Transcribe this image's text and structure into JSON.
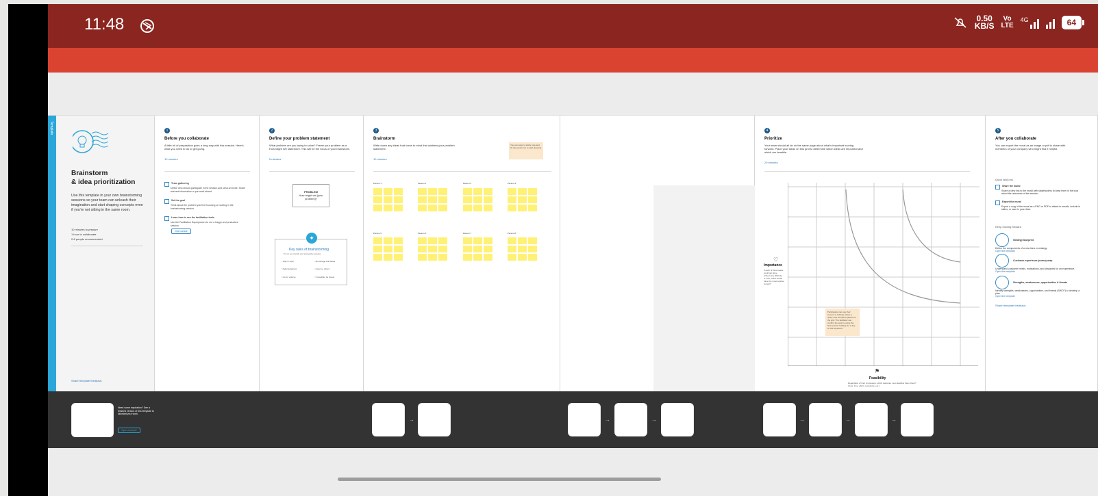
{
  "status_bar": {
    "time": "11:48",
    "net_speed_value": "0.50",
    "net_speed_unit": "KB/S",
    "volte_top": "Vo",
    "volte_bottom": "LTE",
    "network_label": "4G",
    "battery_level": "64",
    "icons": [
      "dnd-icon",
      "mute-icon",
      "signal-4g-icon",
      "signal-icon",
      "battery-icon"
    ]
  },
  "template_strip_label": "Template",
  "panel_intro": {
    "title_line1": "Brainstorm",
    "title_line2": "& idea prioritization",
    "description": "Use this template in your own brainstorming sessions so your team can unleash their imagination and start shaping concepts even if you're not sitting in the same room.",
    "meta": [
      "10 minutes to prepare",
      "1 hour to collaborate",
      "2-8 people recommended"
    ],
    "feedback_link": "Share template feedback"
  },
  "panel_before": {
    "step": "1",
    "title": "Before you collaborate",
    "description": "A little bit of preparation goes a long way with this session. Here's what you need to do to get going.",
    "time": "10 minutes",
    "items": [
      {
        "title": "Team gathering",
        "text": "Define who should participate in the session and send an invite. Share relevant information or pre-work ahead."
      },
      {
        "title": "Set the goal",
        "text": "Think about the problem you'll be focusing on solving in the brainstorming session."
      },
      {
        "title": "Learn how to use the facilitation tools",
        "text": "Use the Facilitation Superpowers to run a happy and productive session."
      }
    ],
    "chip": "Open article"
  },
  "panel_define": {
    "step": "2",
    "title": "Define your problem statement",
    "description": "What problem are you trying to solve? Frame your problem as a How Might We statement. This will be the focus of your brainstorm.",
    "time": "5 minutes",
    "problem_label": "PROBLEM",
    "problem_text": "How might we [your problem]?",
    "rules_title": "Key rules of brainstorming",
    "rules_subtitle": "To run an smooth and productive session",
    "rules": [
      "Stay in topic.",
      "Encourage wild ideas.",
      "Defer judgment.",
      "Listen to others.",
      "Go for volume.",
      "If possible, be visual."
    ]
  },
  "panel_brainstorm": {
    "step": "3",
    "title": "Brainstorm",
    "description": "Write down any ideas that come to mind that address your problem statement.",
    "time": "10 minutes",
    "tip": "You can select a sticky note and hit the pencil icon to start drawing!",
    "persons": [
      "Person 1",
      "Person 2",
      "Person 3",
      "Person 4",
      "Person 5",
      "Person 6",
      "Person 7",
      "Person 8"
    ]
  },
  "panel_prioritize": {
    "step": "4",
    "title": "Prioritize",
    "description": "Your team should all be on the same page about what's important moving forward. Place your ideas on this grid to determine which ideas are important and which are feasible.",
    "time": "20 minutes",
    "y_label": "Importance",
    "y_desc": "If each of these tasks could get done without any difficulty or cost, which would have the most positive impact?",
    "x_label": "Feasibility",
    "x_desc": "Regardless of their importance, which tasks are more feasible than others? (Cost, time, effort, complexity, etc.)",
    "note": "Participants can use their cursors to indicate where a sticky note should be placed on the grid. The facilitator can confirm the spot by using the laser pointer holding the H key on the keyboard."
  },
  "panel_after": {
    "step": "5",
    "title": "After you collaborate",
    "description": "You can export the mural as an image or pdf to share with members of your company who might find it helpful.",
    "quick_label": "Quick add-ons",
    "quick_items": [
      {
        "title": "Share the mural",
        "text": "Share a view link to the mural with stakeholders to keep them in the loop about the outcomes of the session."
      },
      {
        "title": "Export the mural",
        "text": "Export a copy of the mural as a PNG or PDF to attach to emails, include in slides, or save in your drive."
      }
    ],
    "keep_label": "Keep moving forward",
    "keep_items": [
      {
        "title": "Strategy blueprint",
        "text": "Define the components of a new idea or strategy.",
        "link": "Open the template"
      },
      {
        "title": "Customer experience journey map",
        "text": "Understand customer needs, motivations, and obstacles for an experience.",
        "link": "Open the template"
      },
      {
        "title": "Strengths, weaknesses, opportunities & threats",
        "text": "Identify strengths, weaknesses, opportunities, and threats (SWOT) to develop a plan.",
        "link": "Open the template"
      }
    ],
    "feedback_link": "Share template feedback"
  },
  "footer": {
    "inspo_text": "Need some inspiration? See a finished version of this template to kickstart your work.",
    "inspo_button": "Open example"
  }
}
